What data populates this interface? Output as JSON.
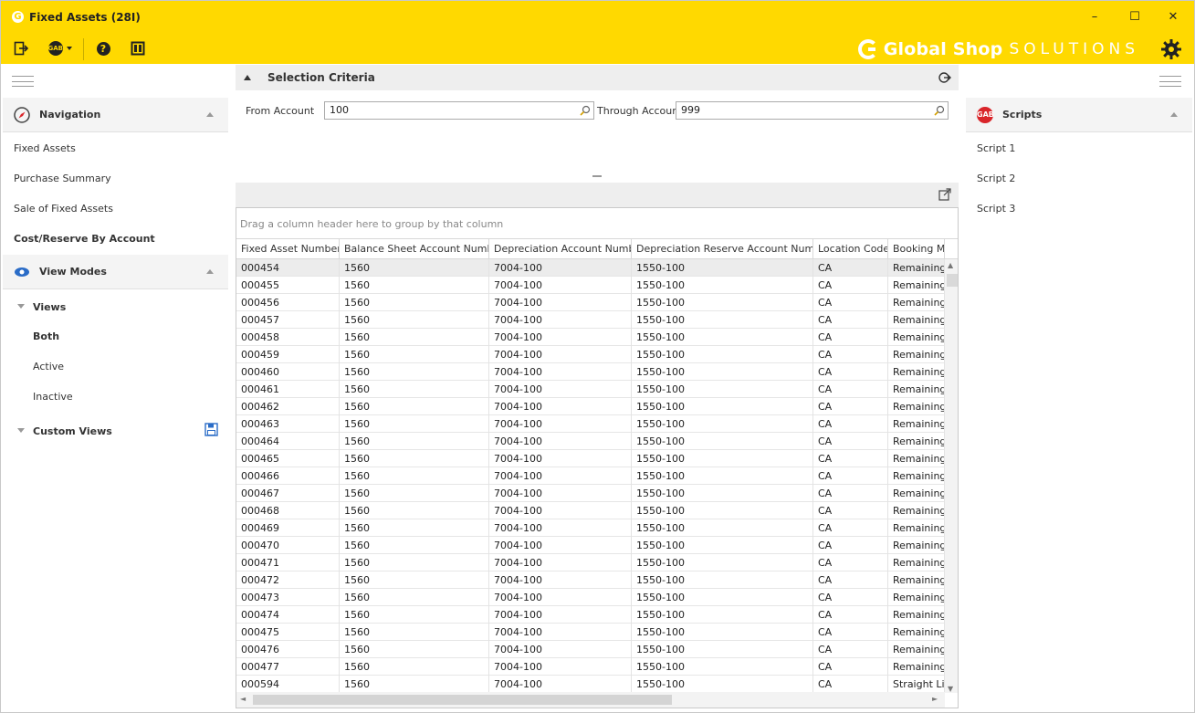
{
  "window": {
    "title": "Fixed Assets (28I)",
    "logo_letter": "G",
    "minimize": "–",
    "maximize": "☐",
    "close": "✕"
  },
  "toolbar": {
    "icons": [
      "exit-icon",
      "gab-dropdown-icon",
      "help-icon",
      "window-layout-icon"
    ],
    "gab_label": "GAB",
    "help_label": "?"
  },
  "brand": {
    "name": "Global Shop",
    "sub": "SOLUTIONS"
  },
  "left_panel": {
    "navigation": {
      "title": "Navigation",
      "items": [
        "Fixed Assets",
        "Purchase Summary",
        "Sale of Fixed Assets",
        "Cost/Reserve By Account"
      ],
      "active_index": 3
    },
    "view_modes": {
      "title": "View Modes",
      "views_label": "Views",
      "views": [
        "Both",
        "Active",
        "Inactive"
      ],
      "active_view_index": 0,
      "custom_views_label": "Custom Views"
    }
  },
  "selection_criteria": {
    "title": "Selection Criteria",
    "from_label": "From Account",
    "from_value": "100",
    "through_label": "Through Account",
    "through_value": "999"
  },
  "grid": {
    "group_panel_text": "Drag a column header here to group by that column",
    "columns": [
      "Fixed Asset Number",
      "Balance Sheet Account Number",
      "Depreciation Account Number",
      "Depreciation Reserve Account Number",
      "Location Code",
      "Booking Method"
    ],
    "rows": [
      [
        "000454",
        "1560",
        "7004-100",
        "1550-100",
        "CA",
        "Remaining Life"
      ],
      [
        "000455",
        "1560",
        "7004-100",
        "1550-100",
        "CA",
        "Remaining Life"
      ],
      [
        "000456",
        "1560",
        "7004-100",
        "1550-100",
        "CA",
        "Remaining Life"
      ],
      [
        "000457",
        "1560",
        "7004-100",
        "1550-100",
        "CA",
        "Remaining Life"
      ],
      [
        "000458",
        "1560",
        "7004-100",
        "1550-100",
        "CA",
        "Remaining Life"
      ],
      [
        "000459",
        "1560",
        "7004-100",
        "1550-100",
        "CA",
        "Remaining Life"
      ],
      [
        "000460",
        "1560",
        "7004-100",
        "1550-100",
        "CA",
        "Remaining Life"
      ],
      [
        "000461",
        "1560",
        "7004-100",
        "1550-100",
        "CA",
        "Remaining Life"
      ],
      [
        "000462",
        "1560",
        "7004-100",
        "1550-100",
        "CA",
        "Remaining Life"
      ],
      [
        "000463",
        "1560",
        "7004-100",
        "1550-100",
        "CA",
        "Remaining Life"
      ],
      [
        "000464",
        "1560",
        "7004-100",
        "1550-100",
        "CA",
        "Remaining Life"
      ],
      [
        "000465",
        "1560",
        "7004-100",
        "1550-100",
        "CA",
        "Remaining Life"
      ],
      [
        "000466",
        "1560",
        "7004-100",
        "1550-100",
        "CA",
        "Remaining Life"
      ],
      [
        "000467",
        "1560",
        "7004-100",
        "1550-100",
        "CA",
        "Remaining Life"
      ],
      [
        "000468",
        "1560",
        "7004-100",
        "1550-100",
        "CA",
        "Remaining Life"
      ],
      [
        "000469",
        "1560",
        "7004-100",
        "1550-100",
        "CA",
        "Remaining Life"
      ],
      [
        "000470",
        "1560",
        "7004-100",
        "1550-100",
        "CA",
        "Remaining Life"
      ],
      [
        "000471",
        "1560",
        "7004-100",
        "1550-100",
        "CA",
        "Remaining Life"
      ],
      [
        "000472",
        "1560",
        "7004-100",
        "1550-100",
        "CA",
        "Remaining Life"
      ],
      [
        "000473",
        "1560",
        "7004-100",
        "1550-100",
        "CA",
        "Remaining Life"
      ],
      [
        "000474",
        "1560",
        "7004-100",
        "1550-100",
        "CA",
        "Remaining Life"
      ],
      [
        "000475",
        "1560",
        "7004-100",
        "1550-100",
        "CA",
        "Remaining Life"
      ],
      [
        "000476",
        "1560",
        "7004-100",
        "1550-100",
        "CA",
        "Remaining Life"
      ],
      [
        "000477",
        "1560",
        "7004-100",
        "1550-100",
        "CA",
        "Remaining Life"
      ],
      [
        "000594",
        "1560",
        "7004-100",
        "1550-100",
        "CA",
        "Straight Line"
      ]
    ],
    "selected_row_index": 0
  },
  "right_panel": {
    "scripts": {
      "title": "Scripts",
      "icon_label": "GAB",
      "items": [
        "Script 1",
        "Script 2",
        "Script 3"
      ]
    }
  },
  "colors": {
    "header": "#ffd900",
    "panel_header": "#f4f4f4",
    "accent_blue": "#2a6cc7",
    "gab_red": "#d9252a"
  }
}
